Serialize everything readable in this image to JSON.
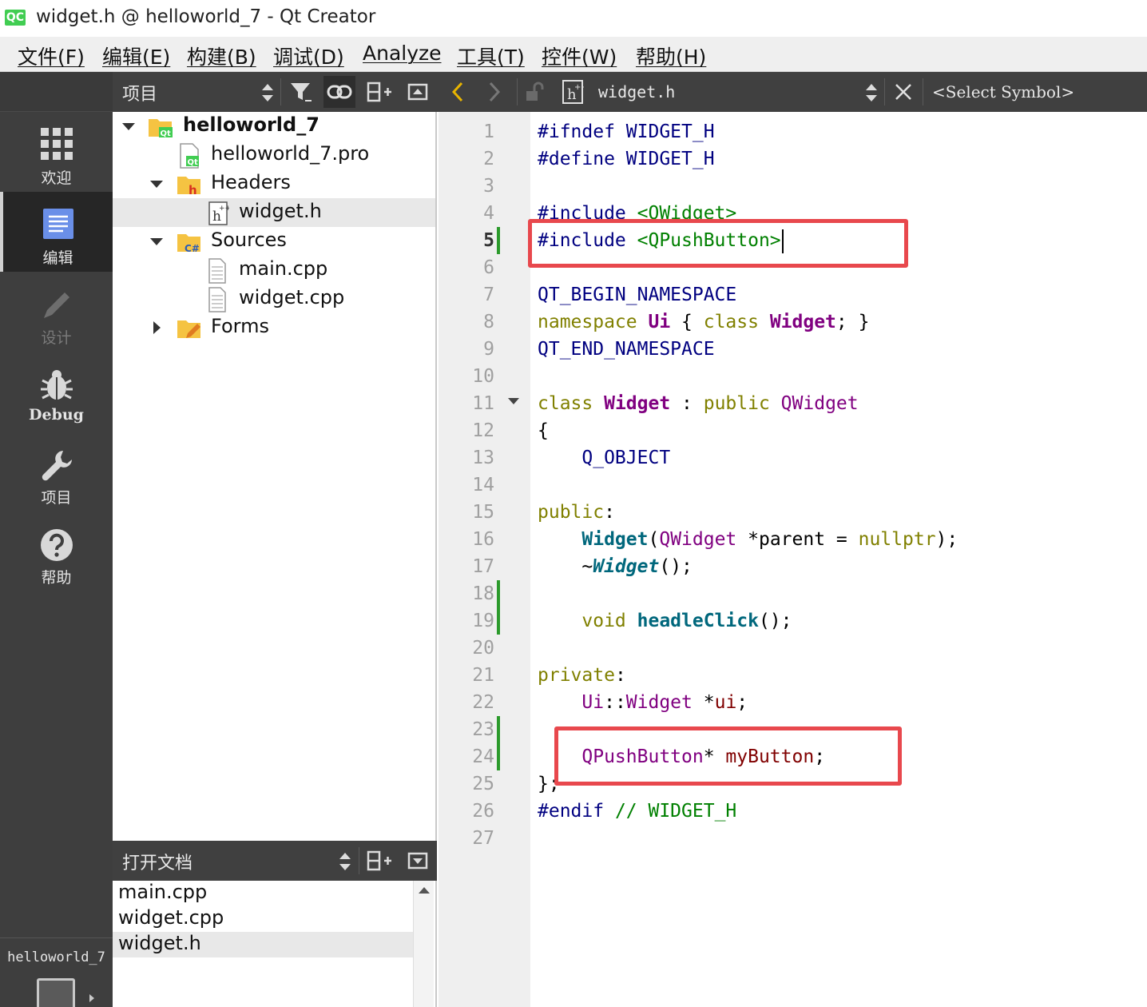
{
  "window": {
    "app_icon": "QC",
    "title": "widget.h @ helloworld_7 - Qt Creator"
  },
  "menu": [
    "文件(F)",
    "编辑(E)",
    "构建(B)",
    "调试(D)",
    "Analyze",
    "工具(T)",
    "控件(W)",
    "帮助(H)"
  ],
  "modes": [
    {
      "id": "welcome",
      "label": "欢迎",
      "icon": "grid-icon",
      "state": "normal"
    },
    {
      "id": "edit",
      "label": "编辑",
      "icon": "document-icon",
      "state": "active"
    },
    {
      "id": "design",
      "label": "设计",
      "icon": "pencil-icon",
      "state": "disabled"
    },
    {
      "id": "debug",
      "label": "Debug",
      "icon": "bug-icon",
      "state": "normal"
    },
    {
      "id": "projects",
      "label": "项目",
      "icon": "wrench-icon",
      "state": "normal"
    },
    {
      "id": "help",
      "label": "帮助",
      "icon": "help-icon",
      "state": "normal"
    }
  ],
  "kit": {
    "label": "helloworld_7"
  },
  "project_panel": {
    "title": "项目",
    "tree": [
      {
        "label": "helloworld_7",
        "kind": "project",
        "expanded": true,
        "bold": true
      },
      {
        "label": "helloworld_7.pro",
        "kind": "pro-file"
      },
      {
        "label": "Headers",
        "kind": "headers-folder",
        "expanded": true
      },
      {
        "label": "widget.h",
        "kind": "header-file",
        "selected": true
      },
      {
        "label": "Sources",
        "kind": "sources-folder",
        "expanded": true
      },
      {
        "label": "main.cpp",
        "kind": "source-file"
      },
      {
        "label": "widget.cpp",
        "kind": "source-file"
      },
      {
        "label": "Forms",
        "kind": "forms-folder",
        "expanded": false
      }
    ]
  },
  "open_docs": {
    "title": "打开文档",
    "items": [
      "main.cpp",
      "widget.cpp",
      "widget.h"
    ],
    "selected": "widget.h"
  },
  "editor": {
    "file_name": "widget.h",
    "symbol_placeholder": "<Select Symbol>",
    "current_line": 5,
    "line_numbers": [
      "1",
      "2",
      "3",
      "4",
      "5",
      "6",
      "7",
      "8",
      "9",
      "10",
      "11",
      "12",
      "13",
      "14",
      "15",
      "16",
      "17",
      "18",
      "19",
      "20",
      "21",
      "22",
      "23",
      "24",
      "25",
      "26",
      "27"
    ],
    "code": {
      "l1a": "#ifndef",
      "l1b": " WIDGET_H",
      "l2a": "#define",
      "l2b": " WIDGET_H",
      "l4a": "#include",
      "l4b": " <QWidget>",
      "l5a": "#include",
      "l5b": " <QPushButton>",
      "l7": "QT_BEGIN_NAMESPACE",
      "l8a": "namespace",
      "l8b": " Ui",
      "l8c": " {",
      "l8d": " class",
      "l8e": " Widget",
      "l8f": "; }",
      "l9": "QT_END_NAMESPACE",
      "l11a": "class",
      "l11b": " Widget",
      "l11c": " :",
      "l11d": " public",
      "l11e": " QWidget",
      "l12": "{",
      "l13": "    Q_OBJECT",
      "l15a": "public",
      "l15b": ":",
      "l16a": "    Widget",
      "l16b": "(",
      "l16c": "QWidget",
      "l16d": " *parent = ",
      "l16e": "nullptr",
      "l16f": ");",
      "l17a": "    ~",
      "l17b": "Widget",
      "l17c": "();",
      "l19a": "    void",
      "l19b": " headleClick",
      "l19c": "();",
      "l21a": "private",
      "l21b": ":",
      "l22a": "    Ui",
      "l22b": "::",
      "l22c": "Widget",
      "l22d": " *",
      "l22e": "ui",
      "l22f": ";",
      "l24a": "    QPushButton",
      "l24b": "* ",
      "l24c": "myButton",
      "l24d": ";",
      "l25": "};",
      "l26a": "#endif",
      "l26b": " //",
      "l26c": " WIDGET_H"
    }
  },
  "annotation_color": "#e8484d"
}
